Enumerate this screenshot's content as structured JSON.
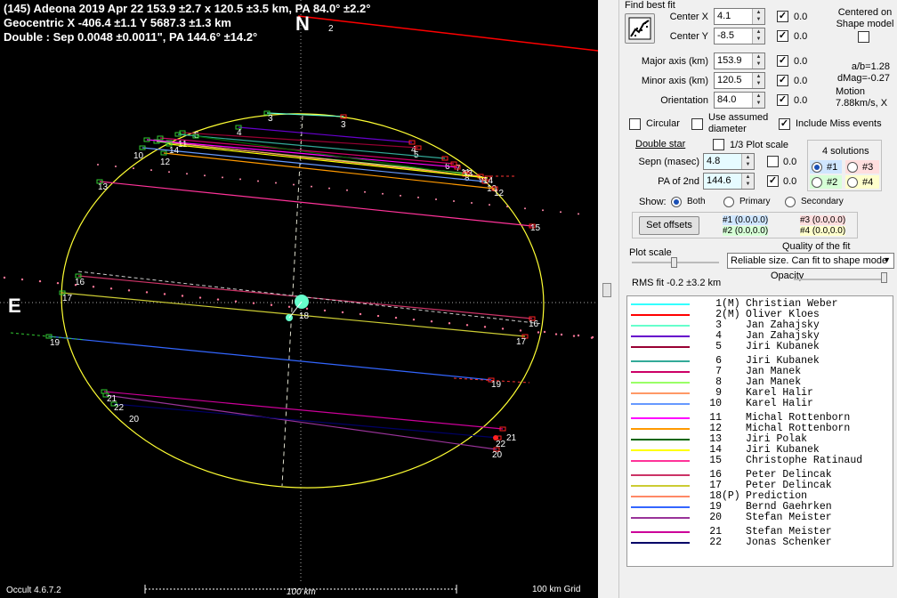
{
  "header": {
    "line1": "(145) Adeona  2019 Apr 22   153.9 ±2.7 x 120.5 ±3.5 km,  PA 84.0° ±2.2°",
    "line2": "Geocentric  X  -406.4 ±1.1   Y 5687.3 ±1.3 km",
    "line3": "Double : Sep  0.0048 ±0.0011\",  PA 144.6° ±14.2°"
  },
  "compass": {
    "north": "N",
    "east": "E"
  },
  "footer": {
    "version": "Occult 4.6.7.2",
    "scale": "100 km",
    "grid": "100 km Grid"
  },
  "panel": {
    "find_best_fit": "Find best fit",
    "center_x_label": "Center X",
    "center_x": "4.1",
    "center_x_step": "0.0",
    "center_y_label": "Center Y",
    "center_y": "-8.5",
    "center_y_step": "0.0",
    "centered_on": "Centered on\nShape model",
    "major_label": "Major axis (km)",
    "major": "153.9",
    "major_step": "0.0",
    "minor_label": "Minor axis (km)",
    "minor": "120.5",
    "minor_step": "0.0",
    "orient_label": "Orientation",
    "orient": "84.0",
    "orient_step": "0.0",
    "ab": "a/b=1.28",
    "dmag": "dMag=-0.27",
    "motion_label": "Motion",
    "motion": "7.88km/s, X",
    "circular": "Circular",
    "use_assumed": "Use assumed\ndiameter",
    "include_miss": "Include Miss events",
    "double_star": "Double star",
    "third_plot": "1/3 Plot scale",
    "sepn_label": "Sepn (masec)",
    "sepn": "4.8",
    "sepn_step": "0.0",
    "pa2_label": "PA of 2nd",
    "pa2": "144.6",
    "pa2_step": "0.0",
    "solutions_title": "4 solutions",
    "sol": [
      "#1",
      "#2",
      "#3",
      "#4"
    ],
    "show_label": "Show:",
    "show_both": "Both",
    "show_primary": "Primary",
    "show_secondary": "Secondary",
    "set_offsets": "Set offsets",
    "off1": "#1 (0.0,0.0)",
    "off2": "#2 (0.0,0.0)",
    "off3": "#3 (0.0,0.0)",
    "off4": "#4 (0.0,0.0)",
    "plot_scale": "Plot scale",
    "quality_label": "Quality of the fit",
    "quality_value": "Reliable size. Can fit to shape mode",
    "opacity": "Opacity",
    "rms": "RMS fit -0.2 ±3.2 km"
  },
  "colors": {
    "ellipse": "#ffff33",
    "cyan_body": "#66ffcc"
  },
  "legend": [
    {
      "num": "1",
      "flag": "(M)",
      "name": "Christian Weber",
      "color": "#33ffff"
    },
    {
      "num": "2",
      "flag": "(M)",
      "name": "Oliver Kloes",
      "color": "#ff0000"
    },
    {
      "num": "3",
      "flag": "",
      "name": "Jan Zahajsky",
      "color": "#66ffcc"
    },
    {
      "num": "4",
      "flag": "",
      "name": "Jan Zahajsky",
      "color": "#6600cc"
    },
    {
      "num": "5",
      "flag": "",
      "name": "Jiri Kubanek",
      "color": "#990033"
    },
    {
      "num": "6",
      "flag": "",
      "name": "Jiri Kubanek",
      "color": "#33aa99"
    },
    {
      "num": "7",
      "flag": "",
      "name": "Jan Manek",
      "color": "#cc0066"
    },
    {
      "num": "8",
      "flag": "",
      "name": "Jan Manek",
      "color": "#99ff66"
    },
    {
      "num": "9",
      "flag": "",
      "name": "Karel Halir",
      "color": "#ff9966"
    },
    {
      "num": "10",
      "flag": "",
      "name": "Karel Halir",
      "color": "#6699ff"
    },
    {
      "num": "11",
      "flag": "",
      "name": "Michal Rottenborn",
      "color": "#ff00ff"
    },
    {
      "num": "12",
      "flag": "",
      "name": "Michal Rottenborn",
      "color": "#ff9900"
    },
    {
      "num": "13",
      "flag": "",
      "name": "Jiri Polak",
      "color": "#006600"
    },
    {
      "num": "14",
      "flag": "",
      "name": "Jiri Kubanek",
      "color": "#ffff00"
    },
    {
      "num": "15",
      "flag": "",
      "name": "Christophe Ratinaud",
      "color": "#ff3399"
    },
    {
      "num": "16",
      "flag": "",
      "name": "Peter Delincak",
      "color": "#cc3366"
    },
    {
      "num": "17",
      "flag": "",
      "name": "Peter Delincak",
      "color": "#cccc33"
    },
    {
      "num": "18",
      "flag": "(P)",
      "name": "Prediction",
      "color": "#ff8866"
    },
    {
      "num": "19",
      "flag": "",
      "name": "Bernd Gaehrken",
      "color": "#3366ff"
    },
    {
      "num": "20",
      "flag": "",
      "name": "Stefan Meister",
      "color": "#993399"
    },
    {
      "num": "21",
      "flag": "",
      "name": "Stefan Meister",
      "color": "#cc0099"
    },
    {
      "num": "22",
      "flag": "",
      "name": "Jonas Schenker",
      "color": "#000066"
    }
  ],
  "chords": [
    {
      "id": "3",
      "color": "#66ffcc",
      "left": "3",
      "right": "3"
    },
    {
      "id": "4",
      "color": "#6600cc",
      "left": "4",
      "right": "4"
    },
    {
      "id": "5",
      "color": "#990033",
      "left": "5",
      "right": "5"
    },
    {
      "id": "6",
      "color": "#33aa99",
      "left": "6",
      "right": "6"
    },
    {
      "id": "7",
      "color": "#cc0066",
      "left": "7",
      "right": "7"
    },
    {
      "id": "8",
      "color": "#99ff66",
      "left": "8",
      "right": "8"
    },
    {
      "id": "9",
      "color": "#ff9966",
      "left": "9",
      "right": "9"
    },
    {
      "id": "10",
      "color": "#6699ff",
      "left": "10",
      "right": "10"
    },
    {
      "id": "11",
      "color": "#ff00ff",
      "left": "11",
      "right": "11"
    },
    {
      "id": "12",
      "color": "#ff9900",
      "left": "12",
      "right": "12"
    },
    {
      "id": "13",
      "color": "#006600",
      "left": "13",
      "right": "13"
    },
    {
      "id": "14",
      "color": "#ffff00",
      "left": "14",
      "right": "14"
    },
    {
      "id": "15",
      "color": "#ff3399",
      "left": "13",
      "right": "15"
    },
    {
      "id": "16",
      "color": "#cc3366",
      "left": "16",
      "right": "16"
    },
    {
      "id": "17",
      "color": "#cccc33",
      "left": "17",
      "right": "17"
    },
    {
      "id": "19",
      "color": "#3366ff",
      "left": "19",
      "right": "19"
    },
    {
      "id": "20",
      "color": "#993399",
      "left": "20",
      "right": "20"
    },
    {
      "id": "21",
      "color": "#cc0099",
      "left": "21",
      "right": "21"
    },
    {
      "id": "22",
      "color": "#000066",
      "left": "22",
      "right": "22"
    }
  ],
  "plot_labels": {
    "north_tick": "2",
    "pred": "18"
  }
}
